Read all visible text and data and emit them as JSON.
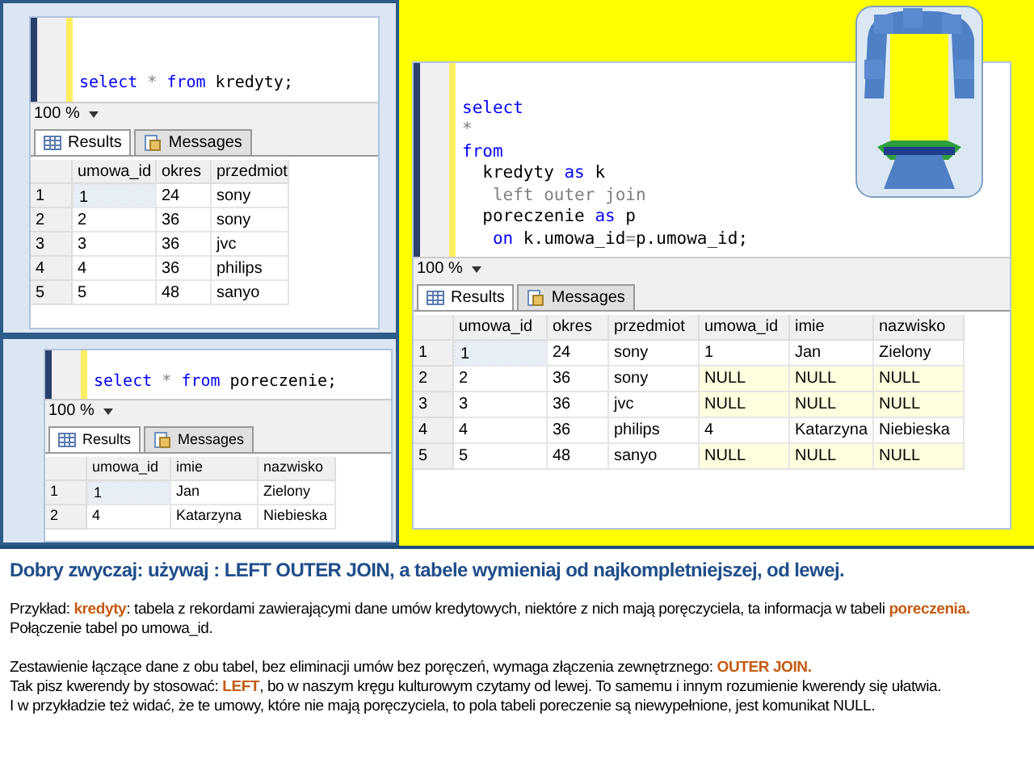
{
  "query_windows": [
    {
      "code_lines": [
        [
          {
            "text": "select",
            "kind": "keyword"
          },
          {
            "text": " * ",
            "kind": "operator"
          },
          {
            "text": "from",
            "kind": "keyword"
          },
          {
            "text": " kredyty;",
            "kind": "plain"
          }
        ]
      ],
      "zoom": "100 %",
      "tabs": [
        {
          "label": "Results",
          "selected": true
        },
        {
          "label": "Messages",
          "selected": false
        }
      ],
      "columns": [
        "umowa_id",
        "okres",
        "przedmiot"
      ],
      "rows": [
        {
          "number": "1",
          "cells": [
            {
              "text": "1",
              "focused": true
            },
            "24",
            "sony"
          ]
        },
        {
          "number": "2",
          "cells": [
            "2",
            "36",
            "sony"
          ]
        },
        {
          "number": "3",
          "cells": [
            "3",
            "36",
            "jvc"
          ]
        },
        {
          "number": "4",
          "cells": [
            "4",
            "36",
            "philips"
          ]
        },
        {
          "number": "5",
          "cells": [
            "5",
            "48",
            "sanyo"
          ]
        }
      ]
    },
    {
      "code_lines": [
        [
          {
            "text": "select",
            "kind": "keyword"
          },
          {
            "text": " * ",
            "kind": "operator"
          },
          {
            "text": "from",
            "kind": "keyword"
          },
          {
            "text": " poreczenie;",
            "kind": "plain"
          }
        ]
      ],
      "zoom": "100 %",
      "tabs": [
        {
          "label": "Results",
          "selected": true
        },
        {
          "label": "Messages",
          "selected": false
        }
      ],
      "columns": [
        "umowa_id",
        "imie",
        "nazwisko"
      ],
      "rows": [
        {
          "number": "1",
          "cells": [
            {
              "text": "1",
              "focused": true
            },
            "Jan",
            "Zielony"
          ]
        },
        {
          "number": "2",
          "cells": [
            "4",
            "Katarzyna",
            "Niebieska"
          ]
        }
      ]
    },
    {
      "code_lines": [
        [
          {
            "text": "select",
            "kind": "keyword"
          }
        ],
        [
          {
            "text": "*",
            "kind": "operator"
          }
        ],
        [
          {
            "text": "from",
            "kind": "keyword"
          }
        ],
        [
          {
            "text": "  kredyty ",
            "kind": "plain"
          },
          {
            "text": "as",
            "kind": "keyword"
          },
          {
            "text": " k",
            "kind": "plain"
          }
        ],
        [
          {
            "text": "   left outer join",
            "kind": "operator"
          }
        ],
        [
          {
            "text": "  poreczenie ",
            "kind": "plain"
          },
          {
            "text": "as",
            "kind": "keyword"
          },
          {
            "text": " p",
            "kind": "plain"
          }
        ],
        [
          {
            "text": "   on",
            "kind": "keyword"
          },
          {
            "text": " k.umowa_id",
            "kind": "plain"
          },
          {
            "text": "=",
            "kind": "operator"
          },
          {
            "text": "p.umowa_id;",
            "kind": "plain"
          }
        ]
      ],
      "zoom": "100 %",
      "tabs": [
        {
          "label": "Results",
          "selected": true
        },
        {
          "label": "Messages",
          "selected": false
        }
      ],
      "columns": [
        "umowa_id",
        "okres",
        "przedmiot",
        "umowa_id",
        "imie",
        "nazwisko"
      ],
      "rows": [
        {
          "number": "1",
          "cells": [
            {
              "text": "1",
              "focused": true
            },
            "24",
            "sony",
            "1",
            "Jan",
            "Zielony"
          ]
        },
        {
          "number": "2",
          "cells": [
            "2",
            "36",
            "sony",
            {
              "text": "NULL",
              "empty": true
            },
            {
              "text": "NULL",
              "empty": true
            },
            {
              "text": "NULL",
              "empty": true
            }
          ]
        },
        {
          "number": "3",
          "cells": [
            "3",
            "36",
            "jvc",
            {
              "text": "NULL",
              "empty": true
            },
            {
              "text": "NULL",
              "empty": true
            },
            {
              "text": "NULL",
              "empty": true
            }
          ]
        },
        {
          "number": "4",
          "cells": [
            "4",
            "36",
            "philips",
            "4",
            "Katarzyna",
            "Niebieska"
          ]
        },
        {
          "number": "5",
          "cells": [
            "5",
            "48",
            "sanyo",
            {
              "text": "NULL",
              "empty": true
            },
            {
              "text": "NULL",
              "empty": true
            },
            {
              "text": "NULL",
              "empty": true
            }
          ]
        }
      ]
    }
  ],
  "heading": "Dobry zwyczaj: używaj : LEFT OUTER JOIN,  a tabele wymieniaj od najkompletniejszej, od lewej.",
  "paragraphs": [
    [
      {
        "text": "Przykład:  ",
        "highlight": false
      },
      {
        "text": "kredyty",
        "highlight": true
      },
      {
        "text": ": tabela z rekordami zawierającymi dane umów kredytowych, niektóre z nich mają poręczyciela,  ta informacja w tabeli ",
        "highlight": false
      },
      {
        "text": "poreczenia.",
        "highlight": true
      },
      {
        "text": "  Połączenie  tabel po umowa_id.",
        "highlight": false
      }
    ],
    [
      {
        "text": "Zestawienie łączące dane z obu tabel,  bez eliminacji umów bez poręczeń, wymaga złączenia  zewnętrznego: ",
        "highlight": false
      },
      {
        "text": "OUTER JOIN.",
        "highlight": true
      }
    ],
    [
      {
        "text": "Tak pisz kwerendy by stosować: ",
        "highlight": false
      },
      {
        "text": "LEFT",
        "highlight": true
      },
      {
        "text": ", bo w naszym kręgu kulturowym  czytamy od lewej. To samemu i innym rozumienie kwerendy się ułatwia.",
        "highlight": false
      }
    ],
    [
      {
        "text": "I w przykładzie też widać, że te umowy, które nie mają poręczyciela, to pola tabeli poreczenie są niewypełnione,  jest komunikat  NULL.",
        "highlight": false
      }
    ]
  ]
}
